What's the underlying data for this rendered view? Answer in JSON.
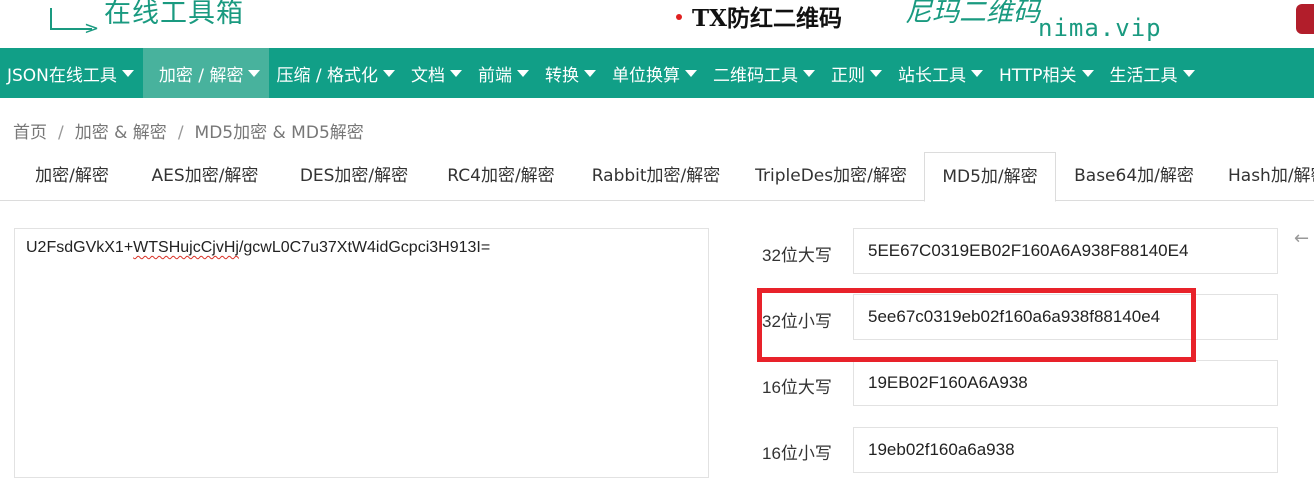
{
  "banner": {
    "slogan": "在线工具箱",
    "middle_text": "TX防红二维码",
    "script_text": "尼玛二维码",
    "domain": "nima.vip"
  },
  "nav": {
    "items": [
      {
        "label": "JSON在线工具"
      },
      {
        "label": "加密 / 解密"
      },
      {
        "label": "压缩 / 格式化"
      },
      {
        "label": "文档"
      },
      {
        "label": "前端"
      },
      {
        "label": "转换"
      },
      {
        "label": "单位换算"
      },
      {
        "label": "二维码工具"
      },
      {
        "label": "正则"
      },
      {
        "label": "站长工具"
      },
      {
        "label": "HTTP相关"
      },
      {
        "label": "生活工具"
      }
    ]
  },
  "breadcrumb": {
    "home": "首页",
    "section": "加密 & 解密",
    "current": "MD5加密 & MD5解密"
  },
  "tabs": [
    {
      "label": "加密/解密"
    },
    {
      "label": "AES加密/解密"
    },
    {
      "label": "DES加密/解密"
    },
    {
      "label": "RC4加密/解密"
    },
    {
      "label": "Rabbit加密/解密"
    },
    {
      "label": "TripleDes加密/解密"
    },
    {
      "label": "MD5加/解密"
    },
    {
      "label": "Base64加/解密"
    },
    {
      "label": "Hash加/解密"
    }
  ],
  "input": {
    "prefix": "U2FsdGVkX1+",
    "misspelled": "WTSHujcCjvHj",
    "suffix": "/gcwL0C7u37XtW4idGcpci3H913I="
  },
  "results": [
    {
      "label": "32位大写",
      "value": "5EE67C0319EB02F160A6A938F88140E4"
    },
    {
      "label": "32位小写",
      "value": "5ee67c0319eb02f160a6a938f88140e4"
    },
    {
      "label": "16位大写",
      "value": "19EB02F160A6A938"
    },
    {
      "label": "16位小写",
      "value": "19eb02f160a6a938"
    }
  ],
  "colors": {
    "nav_background": "#119f87",
    "nav_active": "#48b29d",
    "highlight_border": "#e8222a",
    "brand_teal": "#1a9a80"
  },
  "icons": {
    "side_arrow": "arrow-left-icon"
  }
}
